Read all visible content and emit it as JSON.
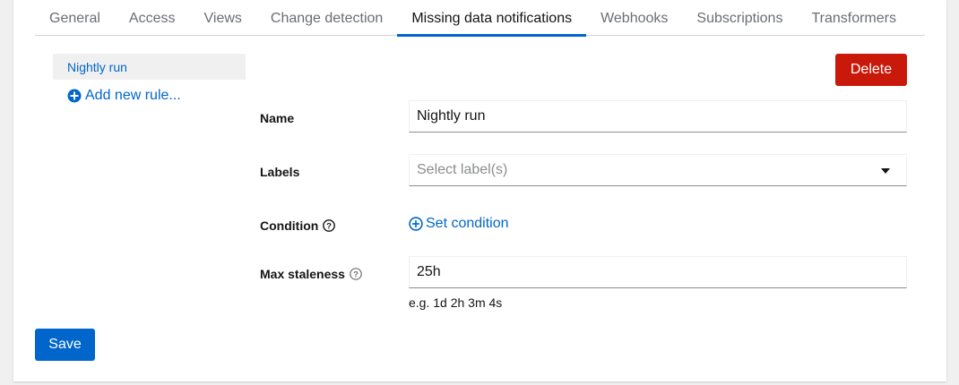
{
  "tabs": [
    {
      "label": "General"
    },
    {
      "label": "Access"
    },
    {
      "label": "Views"
    },
    {
      "label": "Change detection"
    },
    {
      "label": "Missing data notifications",
      "active": true
    },
    {
      "label": "Webhooks"
    },
    {
      "label": "Subscriptions"
    },
    {
      "label": "Transformers"
    }
  ],
  "rules": {
    "items": [
      "Nightly run"
    ],
    "add_label": "Add new rule..."
  },
  "actions": {
    "delete_label": "Delete",
    "save_label": "Save"
  },
  "form": {
    "name_label": "Name",
    "name_value": "Nightly run",
    "labels_label": "Labels",
    "labels_placeholder": "Select label(s)",
    "condition_label": "Condition",
    "set_condition_label": "Set condition",
    "staleness_label": "Max staleness",
    "staleness_value": "25h",
    "staleness_helper": "e.g. 1d 2h 3m 4s"
  },
  "colors": {
    "accent": "#0066cc",
    "danger": "#c9190b"
  }
}
